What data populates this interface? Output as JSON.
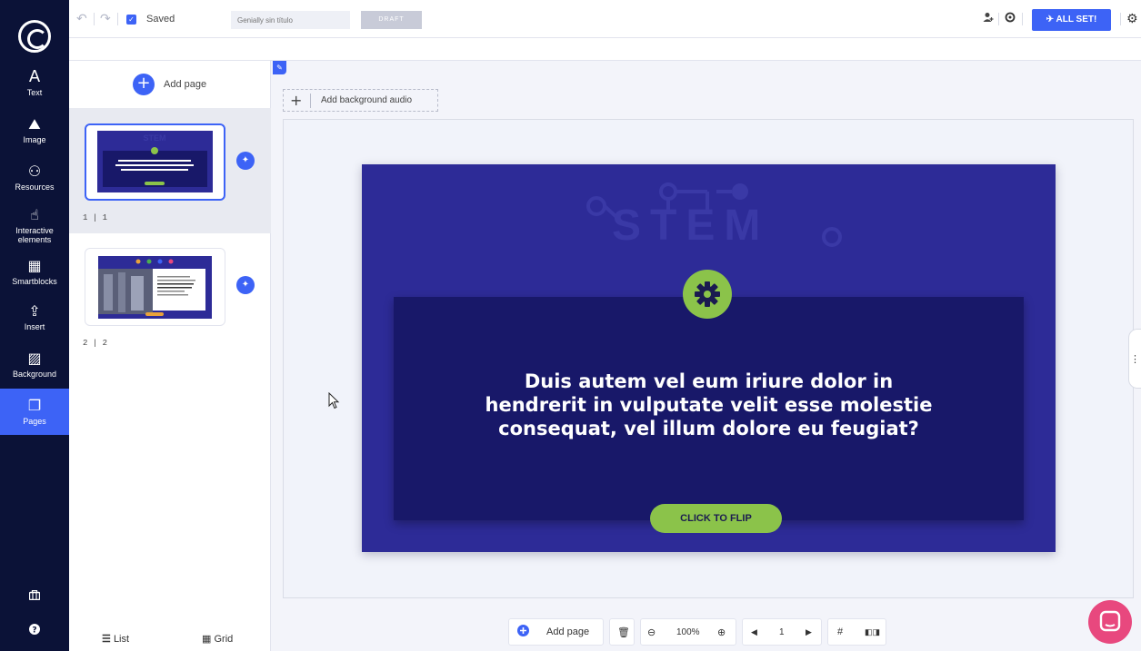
{
  "toolbar": {
    "saved_label": "Saved",
    "title_placeholder": "Genially sin título",
    "draft_label": "DRAFT",
    "all_set_label": "ALL SET!"
  },
  "sidebar": {
    "items": [
      {
        "icon": "text-icon",
        "label": "Text",
        "glyph": "A"
      },
      {
        "icon": "image-icon",
        "label": "Image",
        "glyph": "⛰"
      },
      {
        "icon": "resources-icon",
        "label": "Resources",
        "glyph": "⚇"
      },
      {
        "icon": "interactive-icon",
        "label": "Interactive elements",
        "glyph": "☝"
      },
      {
        "icon": "smartblocks-icon",
        "label": "Smartblocks",
        "glyph": "▦"
      },
      {
        "icon": "insert-icon",
        "label": "Insert",
        "glyph": "⇪"
      },
      {
        "icon": "background-icon",
        "label": "Background",
        "glyph": "▨"
      },
      {
        "icon": "pages-icon",
        "label": "Pages",
        "glyph": "❐"
      }
    ],
    "active": "Pages"
  },
  "pages_panel": {
    "add_page_label": "Add page",
    "pages": [
      {
        "number_label": "1 | 1",
        "selected": true
      },
      {
        "number_label": "2 | 2",
        "selected": false
      }
    ],
    "list_label": "List",
    "grid_label": "Grid"
  },
  "canvas": {
    "bg_audio_label": "Add background audio",
    "slide": {
      "title_word": "STEM",
      "question": "Duis autem vel eum iriure dolor in hendrerit in vulputate velit esse molestie consequat, vel illum dolore eu feugiat?",
      "button_label": "CLICK TO FLIP"
    }
  },
  "bottom_toolbar": {
    "add_page_label": "Add page",
    "zoom": "100%",
    "page_number": "1"
  },
  "colors": {
    "accent": "#3d63f6",
    "rail": "#0b1237",
    "slide_bg": "#2d2b97",
    "card_bg": "#181869",
    "green": "#8bc34a",
    "chat": "#e8487e"
  }
}
